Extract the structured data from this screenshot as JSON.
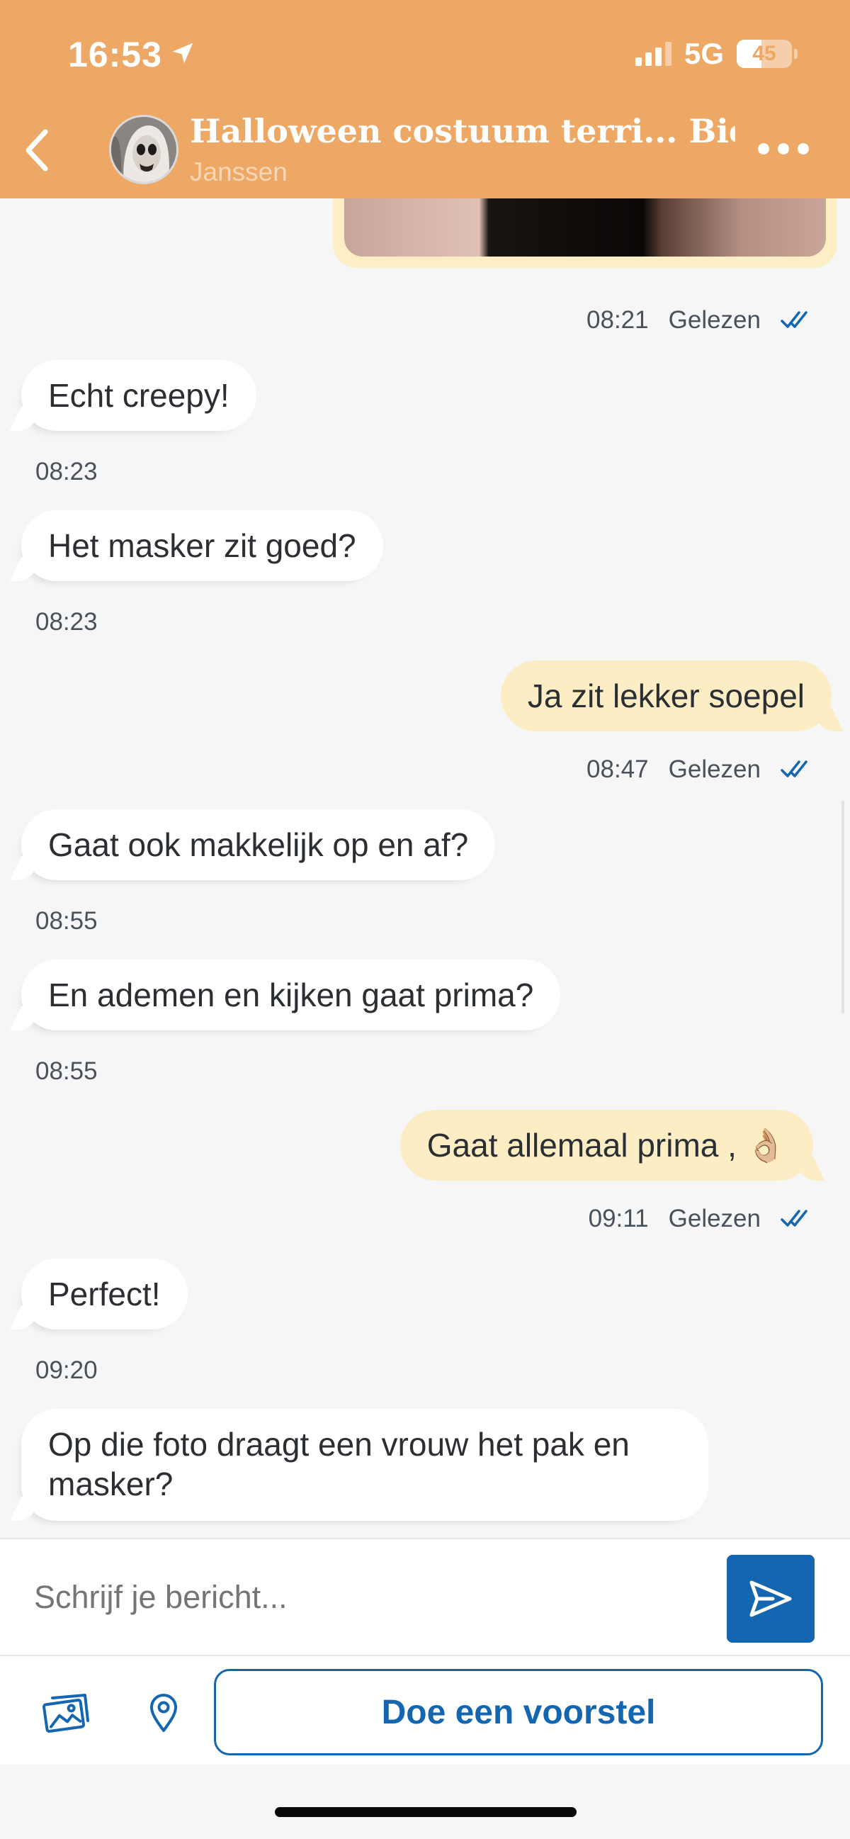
{
  "status_bar": {
    "time": "16:53",
    "network": "5G",
    "battery": "45",
    "battery_level": 0.45
  },
  "header": {
    "title": "Halloween costuum terri... Bieden",
    "subtitle": "Janssen",
    "icons": {
      "back": "chevron-left-icon",
      "menu": "more-horizontal-icon",
      "location": "location-arrow-icon"
    },
    "colors": {
      "background": "#eda866",
      "text": "#ffffff"
    }
  },
  "messages": [
    {
      "direction": "out",
      "type": "image",
      "time": "08:21",
      "status": "Gelezen"
    },
    {
      "direction": "in",
      "text": "Echt creepy!",
      "time": "08:23"
    },
    {
      "direction": "in",
      "text": "Het masker zit goed?",
      "time": "08:23"
    },
    {
      "direction": "out",
      "text": "Ja zit lekker soepel",
      "time": "08:47",
      "status": "Gelezen"
    },
    {
      "direction": "in",
      "text": "Gaat ook makkelijk op en af?",
      "time": "08:55"
    },
    {
      "direction": "in",
      "text": "En ademen en kijken gaat prima?",
      "time": "08:55"
    },
    {
      "direction": "out",
      "text": "Gaat allemaal prima , 👌🏼",
      "time": "09:11",
      "status": "Gelezen"
    },
    {
      "direction": "in",
      "text": "Perfect!",
      "time": "09:20"
    },
    {
      "direction": "in",
      "text": "Op die foto draagt een vrouw het pak en masker?"
    }
  ],
  "composer": {
    "placeholder": "Schrijf je bericht...",
    "send_icon": "send-icon"
  },
  "actions": {
    "gallery_icon": "image-gallery-icon",
    "location_icon": "map-pin-icon",
    "offer_label": "Doe een voorstel"
  },
  "colors": {
    "accent": "#1466b0",
    "outgoing_bubble": "#fdedc4",
    "incoming_bubble": "#ffffff",
    "read_check": "#1466b0"
  }
}
